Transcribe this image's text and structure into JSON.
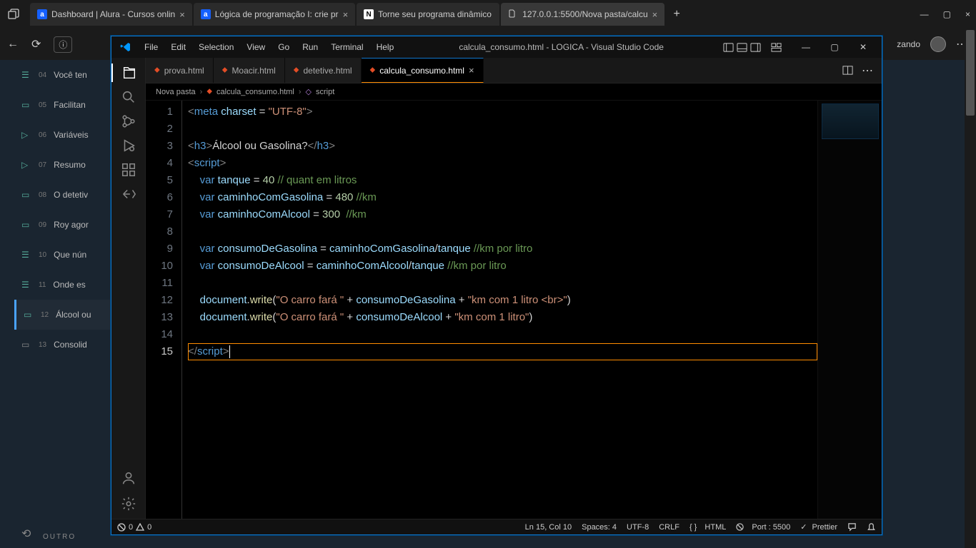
{
  "browser": {
    "tabs": [
      {
        "label": "Dashboard | Alura - Cursos onlin"
      },
      {
        "label": "Lógica de programação I: crie pr"
      },
      {
        "label": "Torne seu programa dinâmico"
      },
      {
        "label": "127.0.0.1:5500/Nova pasta/calcu"
      }
    ],
    "sync": "zando"
  },
  "alura": {
    "items": [
      {
        "n": "04",
        "label": "Você ten"
      },
      {
        "n": "05",
        "label": "Facilitan"
      },
      {
        "n": "06",
        "label": "Variáveis"
      },
      {
        "n": "07",
        "label": "Resumo"
      },
      {
        "n": "08",
        "label": "O detetiv"
      },
      {
        "n": "09",
        "label": "Roy agor"
      },
      {
        "n": "10",
        "label": "Que nún"
      },
      {
        "n": "11",
        "label": "Onde es"
      },
      {
        "n": "12",
        "label": "Álcool ou"
      },
      {
        "n": "13",
        "label": "Consolid"
      }
    ],
    "outro": "OUTRO"
  },
  "vscode": {
    "menu": [
      "File",
      "Edit",
      "Selection",
      "View",
      "Go",
      "Run",
      "Terminal",
      "Help"
    ],
    "title": "calcula_consumo.html - LOGICA - Visual Studio Code",
    "tabs": [
      {
        "label": "prova.html"
      },
      {
        "label": "Moacir.html"
      },
      {
        "label": "detetive.html"
      },
      {
        "label": "calcula_consumo.html"
      }
    ],
    "breadcrumb": {
      "folder": "Nova pasta",
      "file": "calcula_consumo.html",
      "symbol": "script"
    },
    "code": {
      "lines": [
        "1",
        "2",
        "3",
        "4",
        "5",
        "6",
        "7",
        "8",
        "9",
        "10",
        "11",
        "12",
        "13",
        "14",
        "15"
      ],
      "l1_a": "<",
      "l1_tag": "meta",
      "l1_sp": " ",
      "l1_attr": "charset",
      "l1_eq": " = ",
      "l1_str": "\"UTF-8\"",
      "l1_b": ">",
      "l3_a": "<",
      "l3_tag": "h3",
      "l3_b": ">",
      "l3_txt": "Álcool ou Gasolina?",
      "l3_c": "</",
      "l3_d": ">",
      "l4_a": "<",
      "l4_tag": "script",
      "l4_b": ">",
      "l5_kw": "var",
      "l5_v": " tanque",
      "l5_eq": " = ",
      "l5_n": "40",
      "l5_sp": " ",
      "l5_c": "// quant em litros",
      "l6_kw": "var",
      "l6_v": " caminhoComGasolina",
      "l6_eq": " = ",
      "l6_n": "480",
      "l6_sp": " ",
      "l6_c": "//km",
      "l7_kw": "var",
      "l7_v": " caminhoComAlcool",
      "l7_eq": " = ",
      "l7_n": "300",
      "l7_sp": "  ",
      "l7_c": "//km",
      "l9_kw": "var",
      "l9_v": " consumoDeGasolina",
      "l9_eq": " = ",
      "l9_e": "caminhoComGasolina",
      "l9_op": "/",
      "l9_e2": "tanque",
      "l9_sp": " ",
      "l9_c": "//km por litro",
      "l10_kw": "var",
      "l10_v": " consumoDeAlcool",
      "l10_eq": " = ",
      "l10_e": "caminhoComAlcool",
      "l10_op": "/",
      "l10_e2": "tanque",
      "l10_sp": " ",
      "l10_c": "//km por litro",
      "l12_o": "document",
      "l12_d": ".",
      "l12_f": "write",
      "l12_p": "(",
      "l12_s1": "\"O carro fará \"",
      "l12_pl": " + ",
      "l12_v": "consumoDeGasolina",
      "l12_pl2": " + ",
      "l12_s2": "\"km com 1 litro <br>\"",
      "l12_p2": ")",
      "l13_o": "document",
      "l13_d": ".",
      "l13_f": "write",
      "l13_p": "(",
      "l13_s1": "\"O carro fará \"",
      "l13_pl": " + ",
      "l13_v": "consumoDeAlcool",
      "l13_pl2": " + ",
      "l13_s2": "\"km com 1 litro\"",
      "l13_p2": ")",
      "l15_a": "</",
      "l15_tag": "script",
      "l15_b": ">"
    },
    "status": {
      "errors": "0",
      "warnings": "0",
      "pos": "Ln 15, Col 10",
      "spaces": "Spaces: 4",
      "encoding": "UTF-8",
      "eol": "CRLF",
      "lang": "HTML",
      "port": "Port : 5500",
      "prettier": "Prettier"
    }
  }
}
